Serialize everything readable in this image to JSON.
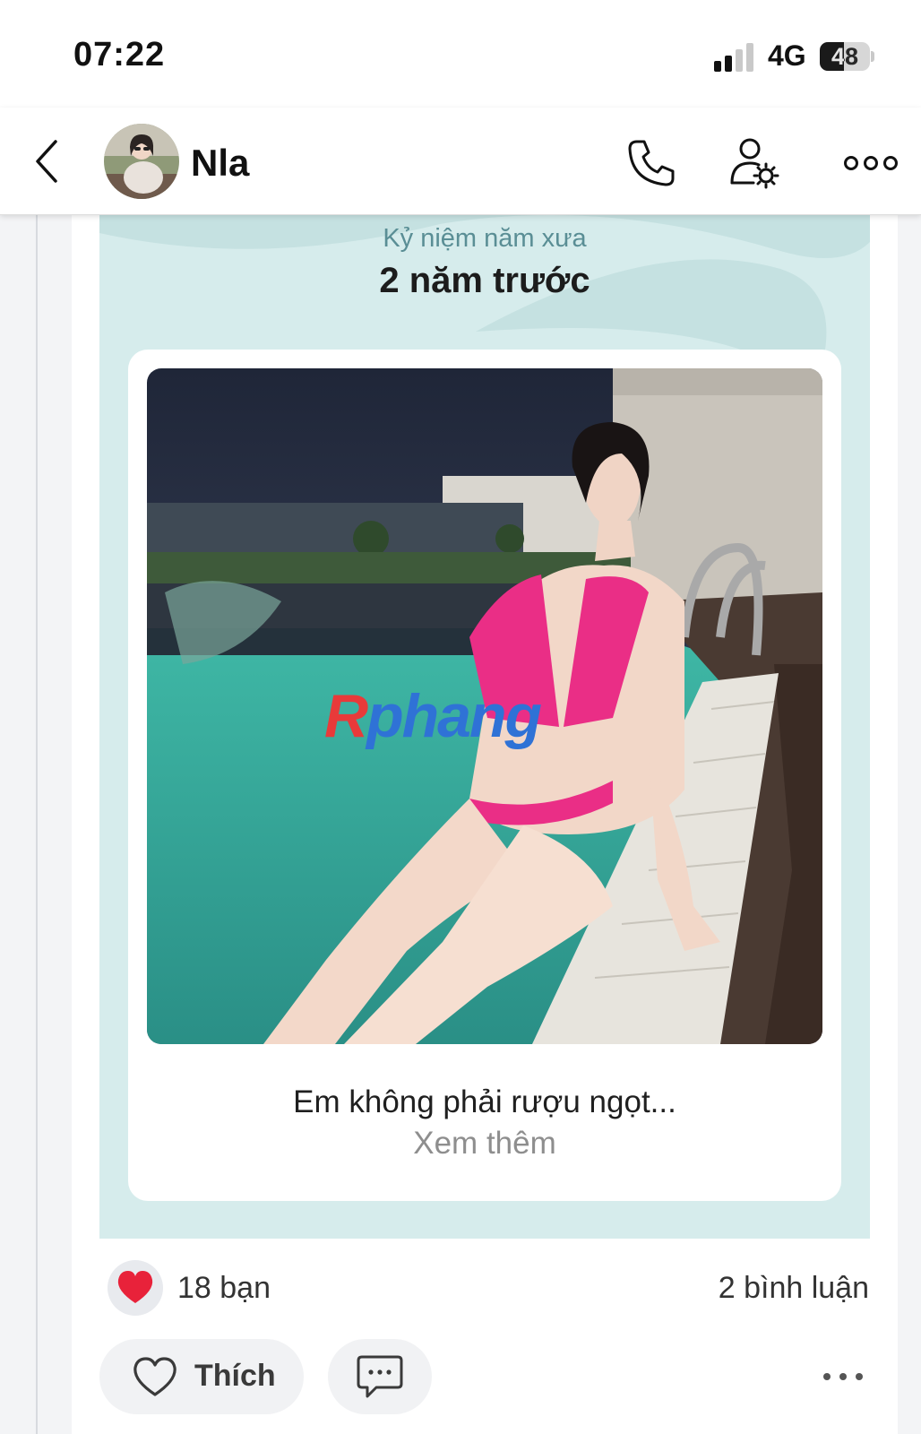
{
  "status_bar": {
    "time": "07:22",
    "network": "4G",
    "battery": "48",
    "battery_level": 0.48
  },
  "header": {
    "contact_name": "Nla"
  },
  "memory": {
    "label": "Kỷ niệm năm xưa",
    "years_ago": "2 năm trước",
    "caption": "Em không phải rượu ngọt...",
    "see_more": "Xem thêm",
    "watermark_a": "R",
    "watermark_b": "phang"
  },
  "reactions": {
    "count_text": "18 bạn",
    "comments_text": "2 bình luận"
  },
  "actions": {
    "like_label": "Thích"
  },
  "colors": {
    "memory_bg": "#d6ecec",
    "heart_red": "#e8223a",
    "wave": "#c5e1e1"
  },
  "icons": {
    "back": "chevron-left-icon",
    "call": "phone-icon",
    "profile_settings": "user-gear-icon",
    "more": "three-dots-icon",
    "reaction": "heart-filled-icon",
    "like": "heart-outline-icon",
    "comment": "chat-bubble-icon"
  }
}
